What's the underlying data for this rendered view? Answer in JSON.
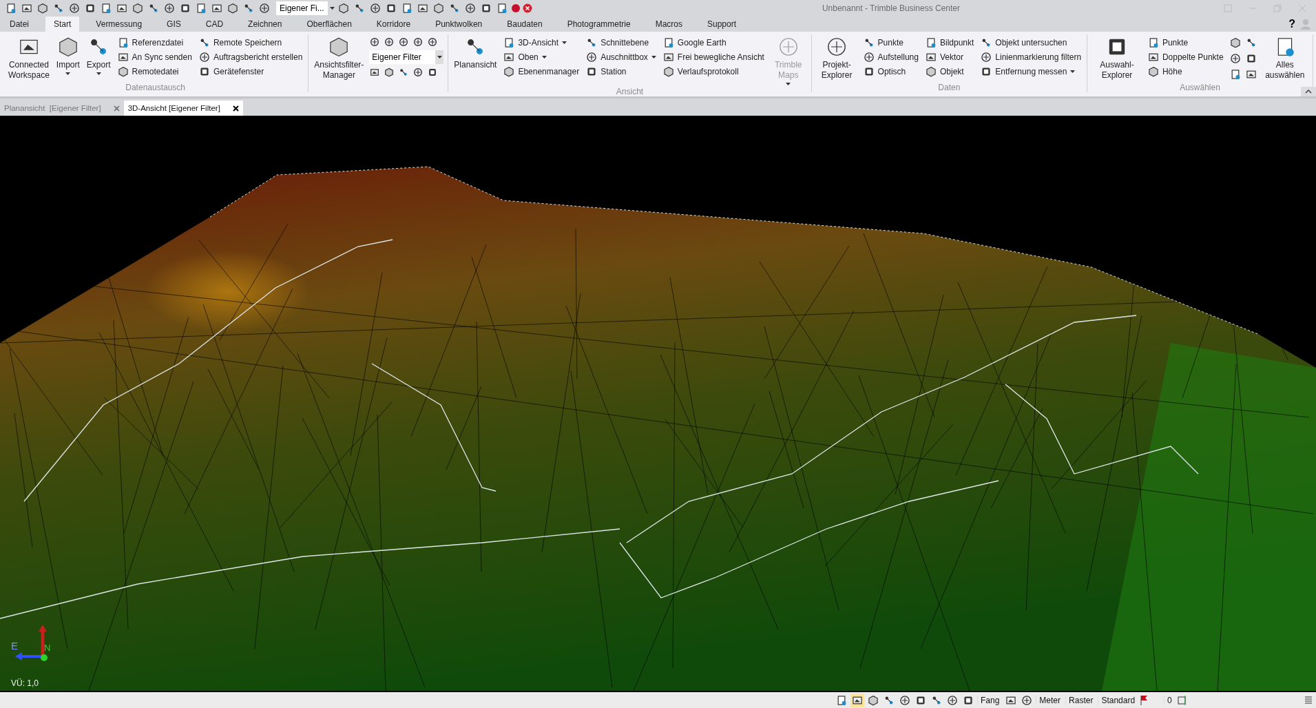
{
  "window": {
    "title": "Unbenannt - Trimble Business Center",
    "help": "?"
  },
  "quick_access": {
    "filter_combo": "Eigener Fi..."
  },
  "menu_tabs": [
    {
      "label": "Datei",
      "selected": false
    },
    {
      "label": "Start",
      "selected": true
    },
    {
      "label": "Vermessung",
      "selected": false
    },
    {
      "label": "GIS",
      "selected": false
    },
    {
      "label": "CAD",
      "selected": false
    },
    {
      "label": "Zeichnen",
      "selected": false
    },
    {
      "label": "Oberflächen",
      "selected": false
    },
    {
      "label": "Korridore",
      "selected": false
    },
    {
      "label": "Punktwolken",
      "selected": false
    },
    {
      "label": "Baudaten",
      "selected": false
    },
    {
      "label": "Photogrammetrie",
      "selected": false
    },
    {
      "label": "Macros",
      "selected": false
    },
    {
      "label": "Support",
      "selected": false
    }
  ],
  "ribbon": {
    "groups": [
      {
        "label": "Datenaustausch",
        "items": [
          {
            "kind": "large",
            "label": "Connected Workspace",
            "dropdown": false,
            "disabled": false
          },
          {
            "kind": "large",
            "label": "Import",
            "dropdown": true,
            "disabled": false
          },
          {
            "kind": "large",
            "label": "Export",
            "dropdown": true,
            "disabled": false
          },
          {
            "kind": "column",
            "buttons": [
              {
                "label": "Referenzdatei",
                "dropdown": false
              },
              {
                "label": "An Sync senden",
                "dropdown": false
              },
              {
                "label": "Remotedatei",
                "dropdown": false
              }
            ]
          },
          {
            "kind": "column",
            "buttons": [
              {
                "label": "Remote Speichern",
                "dropdown": false
              },
              {
                "label": "Auftragsbericht erstellen",
                "dropdown": false
              },
              {
                "label": "Gerätefenster",
                "dropdown": false
              }
            ]
          }
        ]
      },
      {
        "items": [
          {
            "kind": "large",
            "label": "Ansichtsfilter-Manager",
            "dropdown": false,
            "disabled": false
          },
          {
            "kind": "filter_panel",
            "combo": "Eigener Filter"
          }
        ]
      },
      {
        "label": "Ansicht",
        "items": [
          {
            "kind": "large",
            "label": "Planansicht",
            "dropdown": false,
            "disabled": false
          },
          {
            "kind": "column",
            "buttons": [
              {
                "label": "3D-Ansicht",
                "dropdown": true
              },
              {
                "label": "Oben",
                "dropdown": true
              },
              {
                "label": "Ebenenmanager",
                "dropdown": false
              }
            ]
          },
          {
            "kind": "column",
            "buttons": [
              {
                "label": "Schnittebene",
                "dropdown": false
              },
              {
                "label": "Auschnittbox",
                "dropdown": true
              },
              {
                "label": "Station",
                "dropdown": false
              }
            ]
          },
          {
            "kind": "column",
            "buttons": [
              {
                "label": "Google Earth",
                "dropdown": false
              },
              {
                "label": "Frei bewegliche Ansicht",
                "dropdown": false
              },
              {
                "label": "Verlaufsprotokoll",
                "dropdown": false
              }
            ]
          },
          {
            "kind": "large",
            "label": "Trimble Maps",
            "dropdown": true,
            "disabled": true
          }
        ]
      },
      {
        "label": "Daten",
        "items": [
          {
            "kind": "large",
            "label": "Projekt-Explorer",
            "dropdown": false,
            "disabled": false
          },
          {
            "kind": "column",
            "buttons": [
              {
                "label": "Punkte",
                "dropdown": false
              },
              {
                "label": "Aufstellung",
                "dropdown": false
              },
              {
                "label": "Optisch",
                "dropdown": false
              }
            ]
          },
          {
            "kind": "column",
            "buttons": [
              {
                "label": "Bildpunkt",
                "dropdown": false
              },
              {
                "label": "Vektor",
                "dropdown": false
              },
              {
                "label": "Objekt",
                "dropdown": false
              }
            ]
          },
          {
            "kind": "column",
            "buttons": [
              {
                "label": "Objekt untersuchen",
                "dropdown": false
              },
              {
                "label": "Linienmarkierung filtern",
                "dropdown": false
              },
              {
                "label": "Entfernung messen",
                "dropdown": true
              }
            ]
          }
        ]
      },
      {
        "label": "Auswählen",
        "items": [
          {
            "kind": "large",
            "label": "Auswahl-Explorer",
            "dropdown": false,
            "disabled": false
          },
          {
            "kind": "column",
            "buttons": [
              {
                "label": "Punkte",
                "dropdown": false
              },
              {
                "label": "Doppelte Punkte",
                "dropdown": false
              },
              {
                "label": "Höhe",
                "dropdown": false
              }
            ]
          },
          {
            "kind": "icon_grid"
          },
          {
            "kind": "large",
            "label": "Alles auswählen",
            "dropdown": false,
            "disabled": false
          }
        ]
      }
    ]
  },
  "document_tabs": [
    {
      "label": "Planansicht  [Eigener Filter]",
      "selected": false
    },
    {
      "label": "3D-Ansicht [Eigener Filter]",
      "selected": true
    }
  ],
  "viewport": {
    "axis_labels": [
      "E",
      "N"
    ],
    "scale": "VÜ: 1,0"
  },
  "status_bar": {
    "toggles": [
      {
        "selected": false
      },
      {
        "selected": true
      },
      {
        "selected": false
      },
      {
        "selected": false
      },
      {
        "selected": false
      },
      {
        "selected": false
      }
    ],
    "snap": "Fang",
    "units": "Meter",
    "grid": "Raster",
    "style": "Standard",
    "count": "0"
  }
}
